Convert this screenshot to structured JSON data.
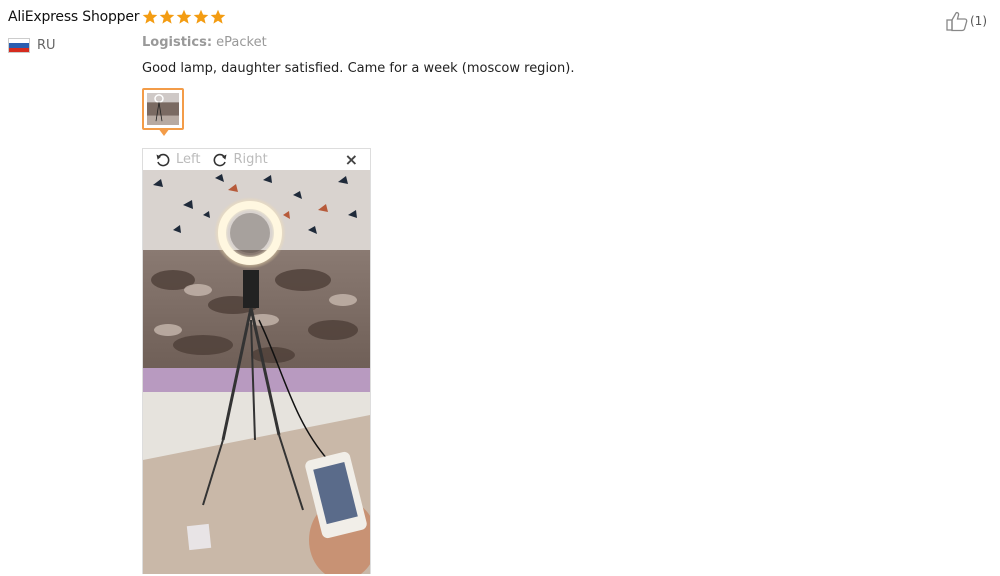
{
  "review": {
    "user_name": "AliExpress Shopper",
    "rating": 5,
    "country_code": "RU",
    "logistics_label": "Logistics:",
    "logistics_value": "ePacket",
    "text": "Good lamp, daughter satisfied. Came for a week (moscow region).",
    "like_count": "(1)"
  },
  "viewer": {
    "rotate_left_label": "Left",
    "rotate_right_label": "Right",
    "close_label": "×"
  },
  "colors": {
    "star": "#f39c12",
    "thumb_border": "#f39c48"
  }
}
